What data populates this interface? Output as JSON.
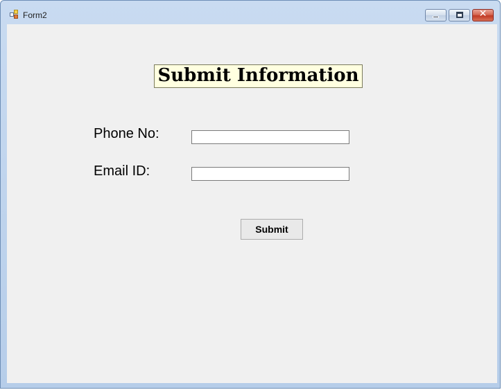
{
  "window": {
    "title": "Form2",
    "icon": "form-app-icon"
  },
  "controls": {
    "minimize": "minimize-icon",
    "maximize": "maximize-icon",
    "close_glyph": "✕"
  },
  "form": {
    "heading": "Submit Information",
    "phone_label": "Phone No:",
    "phone_value": "",
    "email_label": "Email ID:",
    "email_value": "",
    "submit_label": "Submit"
  }
}
